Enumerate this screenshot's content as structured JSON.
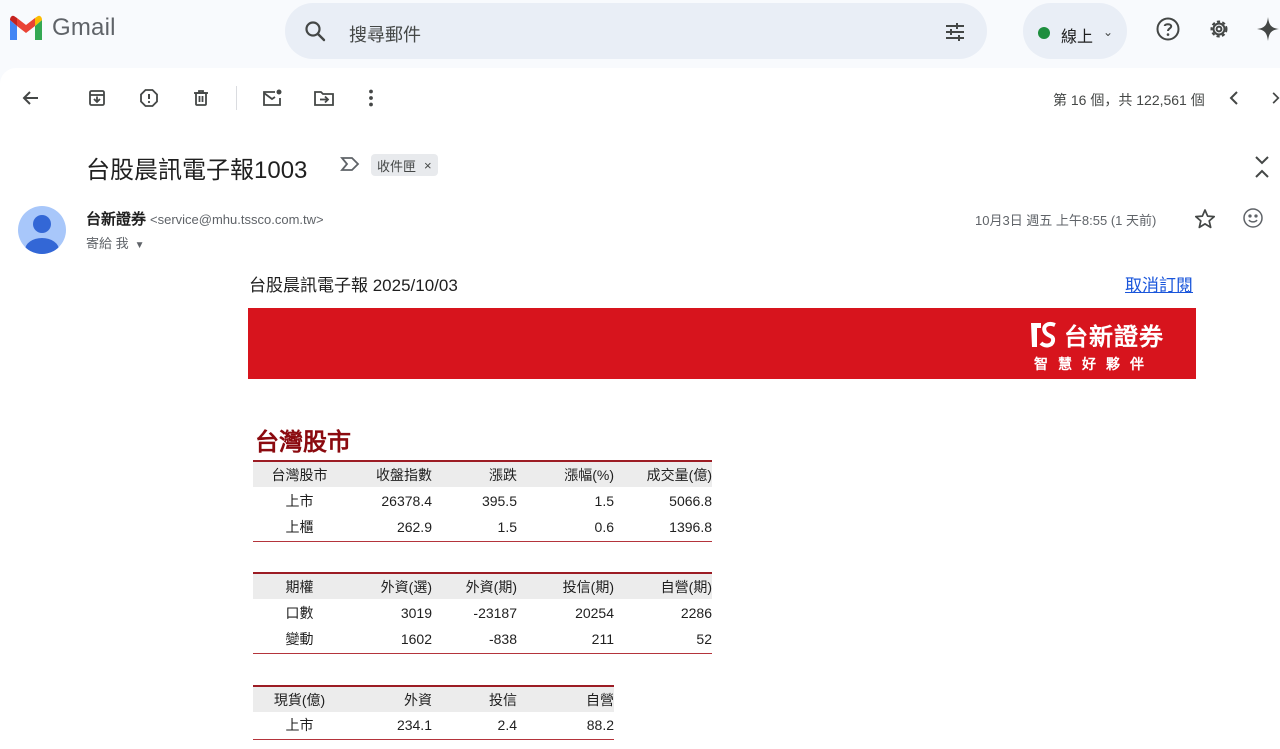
{
  "app": {
    "name": "Gmail",
    "logo_icon": "gmail-m-logo"
  },
  "search": {
    "placeholder": "搜尋郵件"
  },
  "status": {
    "label": "線上",
    "color": "#1e8e3e"
  },
  "pager": {
    "text": "第 16 個，共 122,561 個"
  },
  "email": {
    "subject": "台股晨訊電子報1003",
    "label_chip": "收件匣",
    "label_remove": "×",
    "sender_name": "台新證券",
    "sender_email": "<service@mhu.tssco.com.tw>",
    "to_line": "寄給 我",
    "date": "10月3日 週五 上午8:55 (1 天前)"
  },
  "body": {
    "title": "台股晨訊電子報 2025/10/03",
    "unsubscribe": "取消訂閱",
    "banner": {
      "brand_name": "台新證券",
      "tagline": "智慧好夥伴",
      "color": "#d7141d"
    },
    "section_title": "台灣股市",
    "tables": [
      {
        "headers": [
          "台灣股市",
          "收盤指數",
          "漲跌",
          "漲幅(%)",
          "成交量(億)"
        ],
        "rows": [
          [
            "上市",
            "26378.4",
            "395.5",
            "1.5",
            "5066.8"
          ],
          [
            "上櫃",
            "262.9",
            "1.5",
            "0.6",
            "1396.8"
          ]
        ]
      },
      {
        "headers": [
          "期權",
          "外資(選)",
          "外資(期)",
          "投信(期)",
          "自營(期)"
        ],
        "rows": [
          [
            "口數",
            "3019",
            "-23187",
            "20254",
            "2286"
          ],
          [
            "變動",
            "1602",
            "-838",
            "211",
            "52"
          ]
        ]
      },
      {
        "headers": [
          "現貨(億)",
          "外資",
          "投信",
          "自營"
        ],
        "rows": [
          [
            "上市",
            "234.1",
            "2.4",
            "88.2"
          ]
        ]
      }
    ]
  }
}
